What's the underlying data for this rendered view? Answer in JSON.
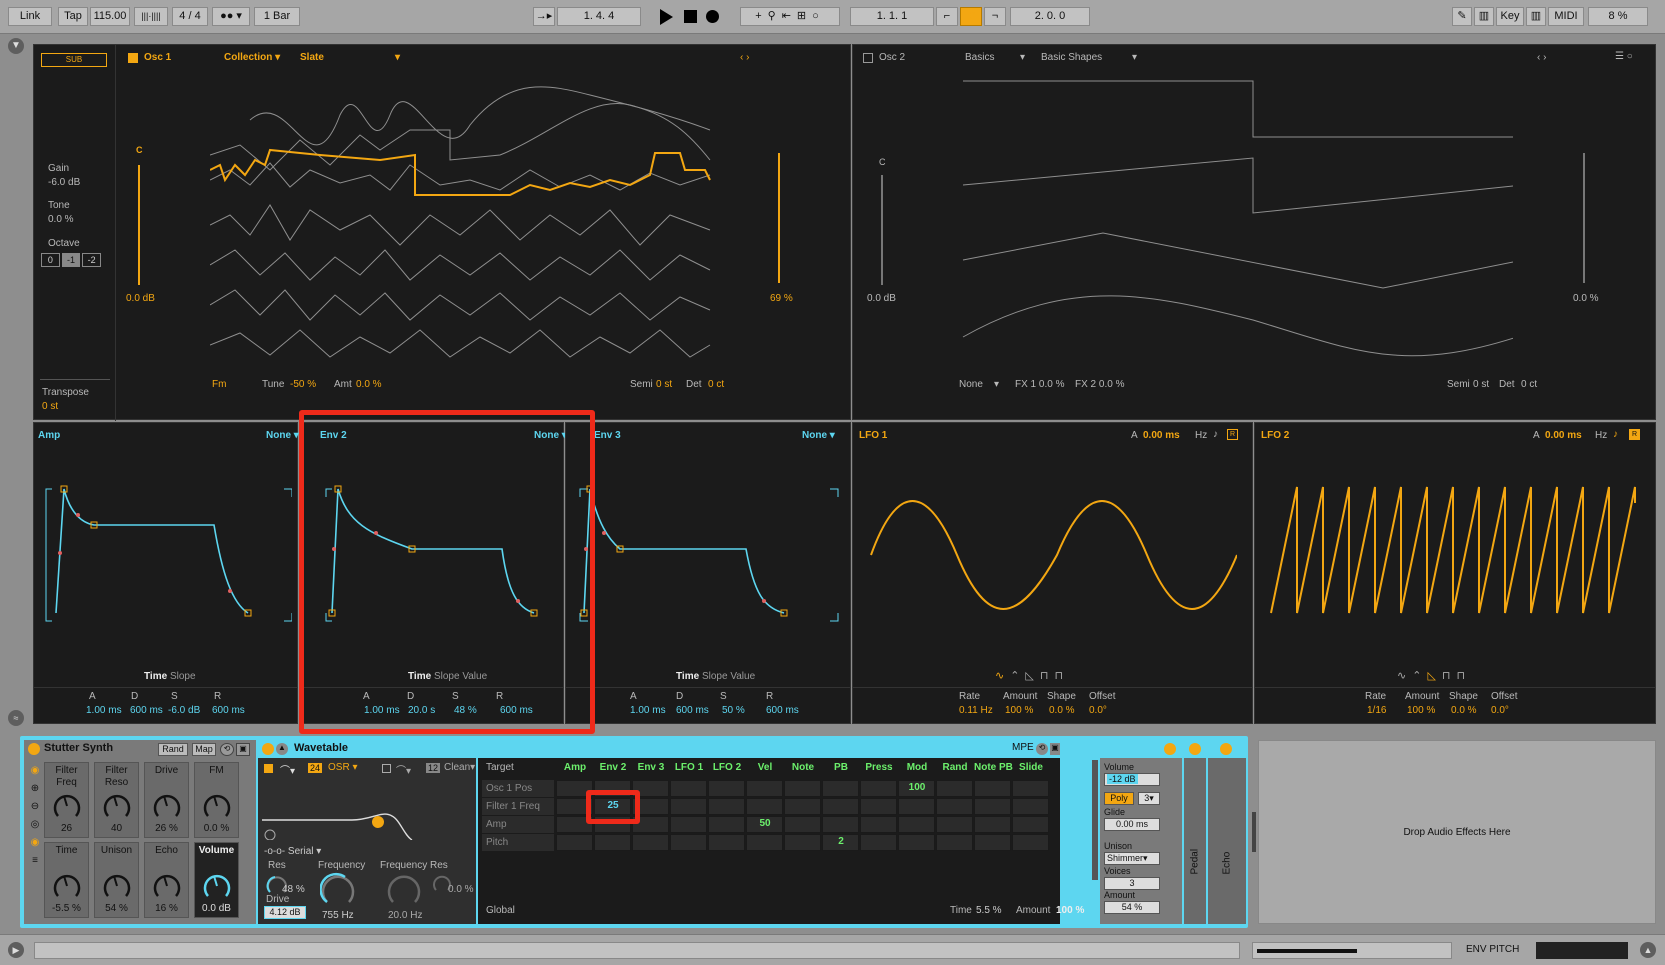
{
  "transport": {
    "link": "Link",
    "tap": "Tap",
    "tempo": "115.00",
    "signature": "4 / 4",
    "quantize": "1 Bar",
    "position": "1.   4.   4",
    "loop_start": "1.   1.   1",
    "loop_length": "2.   0.   0",
    "key": "Key",
    "midi": "MIDI",
    "cpu": "8 %"
  },
  "osc1": {
    "sub": "SUB",
    "title": "Osc 1",
    "collection": "Collection",
    "slate": "Slate",
    "gain_label": "Gain",
    "gain": "-6.0 dB",
    "tone_label": "Tone",
    "tone": "0.0 %",
    "octave_label": "Octave",
    "octaves": [
      "0",
      "-1",
      "-2"
    ],
    "transpose_label": "Transpose",
    "transpose": "0 st",
    "pitch_label": "C",
    "level": "0.0 dB",
    "position": "69 %",
    "fm": "Fm",
    "tune_label": "Tune",
    "tune": "-50 %",
    "amt_label": "Amt",
    "amt": "0.0 %",
    "semi_label": "Semi",
    "semi": "0 st",
    "det_label": "Det",
    "det": "0 ct"
  },
  "osc2": {
    "title": "Osc 2",
    "category": "Basics",
    "table": "Basic Shapes",
    "pitch_label": "C",
    "level": "0.0 dB",
    "position": "0.0 %",
    "fx_mode": "None",
    "fx1": "FX 1  0.0 %",
    "fx2": "FX 2  0.0 %",
    "semi_label": "Semi",
    "semi": "0 st",
    "det_label": "Det",
    "det": "0 ct"
  },
  "envelopes": [
    {
      "name": "Amp",
      "target": "None",
      "tabs": [
        "Time",
        "Slope"
      ],
      "labels": [
        "A",
        "D",
        "S",
        "R"
      ],
      "values": [
        "1.00 ms",
        "600 ms",
        "-6.0 dB",
        "600 ms"
      ]
    },
    {
      "name": "Env 2",
      "target": "None",
      "tabs": [
        "Time",
        "Slope",
        "Value"
      ],
      "labels": [
        "A",
        "D",
        "S",
        "R"
      ],
      "values": [
        "1.00 ms",
        "20.0 s",
        "48 %",
        "600 ms"
      ]
    },
    {
      "name": "Env 3",
      "target": "None",
      "tabs": [
        "Time",
        "Slope",
        "Value"
      ],
      "labels": [
        "A",
        "D",
        "S",
        "R"
      ],
      "values": [
        "1.00 ms",
        "600 ms",
        "50 %",
        "600 ms"
      ]
    }
  ],
  "lfos": [
    {
      "name": "LFO 1",
      "a_label": "A",
      "attack": "0.00 ms",
      "unit": "Hz",
      "labels": [
        "Rate",
        "Amount",
        "Shape",
        "Offset"
      ],
      "values": [
        "0.11 Hz",
        "100 %",
        "0.0 %",
        "0.0°"
      ]
    },
    {
      "name": "LFO 2",
      "a_label": "A",
      "attack": "0.00 ms",
      "unit": "Hz",
      "labels": [
        "Rate",
        "Amount",
        "Shape",
        "Offset"
      ],
      "values": [
        "1/16",
        "100 %",
        "0.0 %",
        "0.0°"
      ]
    }
  ],
  "rack": {
    "name": "Stutter Synth",
    "rand": "Rand",
    "map": "Map",
    "macros": [
      {
        "label": "Filter\nFreq",
        "value": "26"
      },
      {
        "label": "Filter\nReso",
        "value": "40"
      },
      {
        "label": "Drive",
        "value": "26 %"
      },
      {
        "label": "FM",
        "value": "0.0 %"
      },
      {
        "label": "Time",
        "value": "-5.5 %"
      },
      {
        "label": "Unison",
        "value": "54 %"
      },
      {
        "label": "Echo",
        "value": "16 %"
      },
      {
        "label": "Volume",
        "value": "0.0 dB"
      }
    ]
  },
  "wavetable": {
    "name": "Wavetable",
    "slope": "24",
    "osr": "OSR",
    "slope2": "12",
    "clean": "Clean",
    "routing": "Serial",
    "res_label": "Res",
    "res": "48 %",
    "drive_label": "Drive",
    "drive": "4.12 dB",
    "freq_label": "Frequency",
    "freq": "755 Hz",
    "fres_label": "Frequency  Res",
    "fres_freq": "20.0 Hz",
    "fres_res": "0.0 %",
    "mpe": "MPE"
  },
  "matrix": {
    "target_label": "Target",
    "columns": [
      "Amp",
      "Env 2",
      "Env 3",
      "LFO 1",
      "LFO 2",
      "Vel",
      "Note",
      "PB",
      "Press",
      "Mod",
      "Rand",
      "Note PB",
      "Slide"
    ],
    "rows": [
      "Osc 1 Pos",
      "Filter 1 Freq",
      "Amp",
      "Pitch"
    ],
    "cells": [
      {
        "row": 0,
        "col": 9,
        "value": "100"
      },
      {
        "row": 1,
        "col": 1,
        "value": "25"
      },
      {
        "row": 2,
        "col": 5,
        "value": "50"
      },
      {
        "row": 3,
        "col": 7,
        "value": "2"
      }
    ],
    "global": "Global",
    "time_label": "Time",
    "time": "5.5 %",
    "amount_label": "Amount",
    "amount": "100 %"
  },
  "voice": {
    "volume_label": "Volume",
    "volume": "-12 dB",
    "poly": "Poly",
    "voices_count": "3",
    "glide_label": "Glide",
    "glide": "0.00 ms",
    "unison_label": "Unison",
    "unison_mode": "Shimmer",
    "voices_label": "Voices",
    "voices": "3",
    "amount_label": "Amount",
    "amount": "54 %",
    "pedal": "Pedal",
    "echo": "Echo"
  },
  "drop": "Drop Audio Effects Here",
  "bottom": {
    "env_pitch": "ENV PITCH"
  },
  "colors": {
    "accent": "#f3a712",
    "mod": "#5dd6f0",
    "highlight": "#ef2a1a",
    "matrix_value": "#6cf06c"
  }
}
